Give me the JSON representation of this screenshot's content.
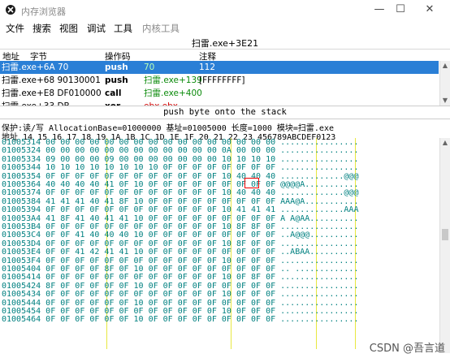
{
  "window": {
    "title": "内存浏览器",
    "min": "—",
    "max": "☐",
    "close": "✕"
  },
  "menu": [
    "文件",
    "搜索",
    "视图",
    "调试",
    "工具",
    "内核工具"
  ],
  "address_bar": "扫雷.exe+3E21",
  "columns": {
    "addr": "地址",
    "bytes": "字节",
    "opcode": "操作码",
    "comment": "注释"
  },
  "disasm": [
    {
      "addr": "扫雷.exe+6A 70",
      "op": "push",
      "arg": "70",
      "comment": "112",
      "selected": true
    },
    {
      "addr": "扫雷.exe+68 90130001",
      "op": "push",
      "arg": "扫雷.exe+139",
      "comment": "[FFFFFFFF]"
    },
    {
      "addr": "扫雷.exe+E8 DF010000",
      "op": "call",
      "arg": "扫雷.exe+400",
      "comment": ""
    },
    {
      "addr": "扫雷.exe+33 DB",
      "op": "xor",
      "arg": "ebx,ebx",
      "comment": ""
    }
  ],
  "status": "push byte onto the stack",
  "mem_info": "保护:读/写  AllocationBase=01000000 基址=01005000 长度=1000 模块=扫雷.exe",
  "hex_header": "地址      14 15 16 17 18 19 1A 1B 1C 1D 1E 1F 20 21 22 23 456789ABCDEF0123",
  "hex_rows": [
    {
      "addr": "01005314",
      "bytes": "00 00 00 00 00 00 00 00 00 00 00 00 00 00 00 00",
      "ascii": "................"
    },
    {
      "addr": "01005324",
      "bytes": "00 00 00 00 00 00 00 00 00 00 00 00 0A 00 00 00",
      "ascii": "................"
    },
    {
      "addr": "01005334",
      "bytes": "09 00 00 00 09 00 00 00 00 00 00 00 10 10 10 10",
      "ascii": "................"
    },
    {
      "addr": "01005344",
      "bytes": "10 10 10 10 10 10 10 10 0F 0F 0F 0F 0F 0F 0F 0F",
      "ascii": "................"
    },
    {
      "addr": "01005354",
      "bytes": "0F 0F 0F 0F 0F 0F 0F 0F 0F 0F 0F 0F 10 40 40 40",
      "ascii": ".............@@@"
    },
    {
      "addr": "01005364",
      "bytes": "40 40 40 40 41 0F 10 0F 0F 0F 0F 0F 0F 0F 0F 0F",
      "ascii": "@@@@A..........."
    },
    {
      "addr": "01005374",
      "bytes": "0F 0F 0F 0F 0F 0F 0F 0F 0F 0F 0F 0F 10 40 40 40",
      "ascii": ".............@@@"
    },
    {
      "addr": "01005384",
      "bytes": "41 41 41 40 41 8F 10 0F 0F 0F 0F 0F 0F 0F 0F 0F",
      "ascii": "AAA@A..........."
    },
    {
      "addr": "01005394",
      "bytes": "0F 0F 0F 0F 0F 0F 0F 0F 0F 0F 0F 0F 10 41 41 41",
      "ascii": ".............AAA"
    },
    {
      "addr": "010053A4",
      "bytes": "41 8F 41 40 41 41 10 0F 0F 0F 0F 0F 0F 0F 0F 0F",
      "ascii": "A A@AA.........."
    },
    {
      "addr": "010053B4",
      "bytes": "0F 0F 0F 0F 0F 0F 0F 0F 0F 0F 0F 0F 10 8F 8F 0F",
      "ascii": "................"
    },
    {
      "addr": "010053C4",
      "bytes": "0F 0F 41 40 40 40 10 0F 0F 0F 0F 0F 0F 0F 0F 0F",
      "ascii": "..A@@@.........."
    },
    {
      "addr": "010053D4",
      "bytes": "0F 0F 0F 0F 0F 0F 0F 0F 0F 0F 0F 0F 10 8F 0F 0F",
      "ascii": "................"
    },
    {
      "addr": "010053E4",
      "bytes": "0F 0F 41 42 41 41 10 0F 0F 0F 0F 0F 0F 0F 0F 0F",
      "ascii": "..ABAA.........."
    },
    {
      "addr": "010053F4",
      "bytes": "0F 0F 0F 0F 0F 0F 0F 0F 0F 0F 0F 0F 10 0F 0F 0F",
      "ascii": "................"
    },
    {
      "addr": "01005404",
      "bytes": "0F 0F 0F 0F 8F 0F 10 0F 0F 0F 0F 0F 0F 0F 0F 0F",
      "ascii": ".. ............."
    },
    {
      "addr": "01005414",
      "bytes": "0F 0F 0F 0F 0F 0F 0F 0F 0F 0F 0F 0F 10 0F 8F 0F",
      "ascii": "................"
    },
    {
      "addr": "01005424",
      "bytes": "8F 0F 0F 0F 0F 0F 10 0F 0F 0F 0F 0F 0F 0F 0F 0F",
      "ascii": "................"
    },
    {
      "addr": "01005434",
      "bytes": "0F 0F 0F 0F 0F 0F 0F 0F 0F 0F 0F 0F 10 0F 0F 0F",
      "ascii": "................"
    },
    {
      "addr": "01005444",
      "bytes": "0F 0F 0F 0F 0F 0F 10 0F 0F 0F 0F 0F 0F 0F 0F 0F",
      "ascii": "................"
    },
    {
      "addr": "01005454",
      "bytes": "0F 0F 0F 0F 0F 0F 0F 0F 0F 0F 0F 0F 10 0F 0F 0F",
      "ascii": "................"
    },
    {
      "addr": "01005464",
      "bytes": "0F 0F 0F 0F 0F 0F 10 0F 0F 0F 0F 0F 0F 0F 0F 0F",
      "ascii": "................"
    }
  ],
  "watermark": "CSDN @吾言道"
}
